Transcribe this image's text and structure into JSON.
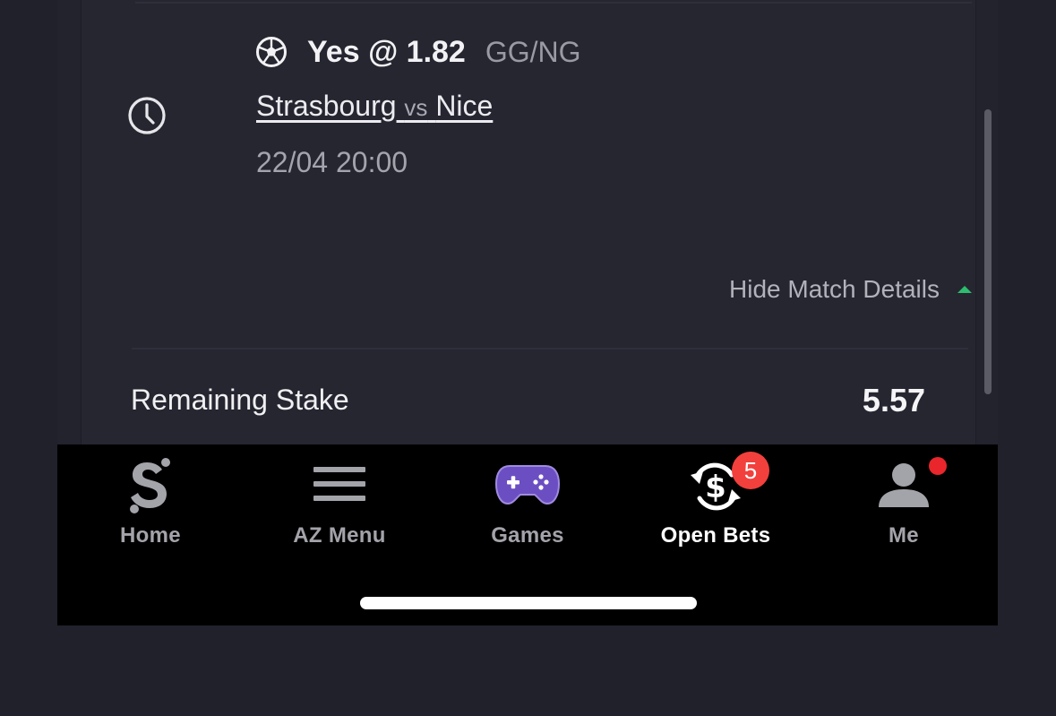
{
  "bet": {
    "selection": "Yes @ 1.82",
    "market": "GG/NG",
    "home_team": "Strasbourg",
    "vs": "vs",
    "away_team": "Nice",
    "datetime": "22/04 20:00",
    "hide_details_label": "Hide Match Details",
    "remaining_stake_label": "Remaining Stake",
    "remaining_stake_value": "5.57"
  },
  "tabbar": {
    "home": "Home",
    "az_menu": "AZ Menu",
    "games": "Games",
    "open_bets": "Open Bets",
    "open_bets_badge": "5",
    "me": "Me",
    "active": "open_bets"
  },
  "icons": {
    "status": "clock-icon",
    "sport": "soccer-ball-icon",
    "toggle": "caret-up-icon",
    "home": "brand-s-icon",
    "az_menu": "hamburger-menu-icon",
    "games": "gamepad-icon",
    "open_bets": "dollar-refresh-icon",
    "me": "user-icon"
  },
  "colors": {
    "background": "#21212c",
    "card": "#262631",
    "tabbar": "#000000",
    "games_icon": "#6b4fc2",
    "badge": "#f2403d",
    "accent_green": "#2dbd6e"
  }
}
